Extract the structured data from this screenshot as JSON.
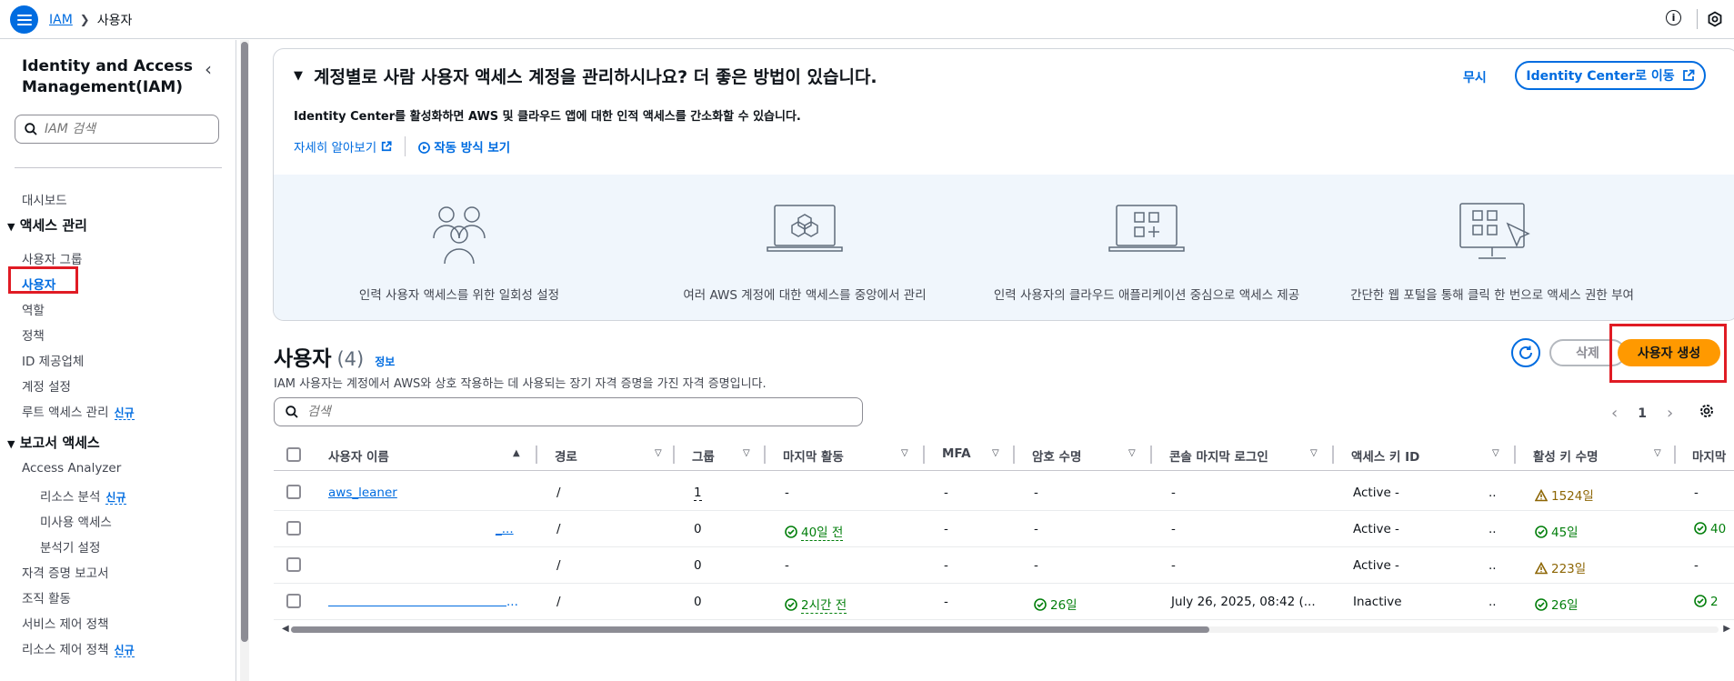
{
  "topbar": {
    "breadcrumb_root": "IAM",
    "breadcrumb_current": "사용자"
  },
  "sidebar": {
    "title": "Identity and Access Management(IAM)",
    "search_placeholder": "IAM 검색",
    "dashboard": "대시보드",
    "access_mgmt": "액세스 관리",
    "user_groups": "사용자 그룹",
    "users": "사용자",
    "roles": "역할",
    "policies": "정책",
    "idp": "ID 제공업체",
    "account_settings": "계정 설정",
    "root_access": "루트 액세스 관리",
    "new_badge": "신규",
    "reports": "보고서 액세스",
    "analyzer": "Access Analyzer",
    "resource_analysis": "리소스 분석",
    "unused_access": "미사용 액세스",
    "analyzer_settings": "분석기 설정",
    "cred_report": "자격 증명 보고서",
    "org_activity": "조직 활동",
    "scp": "서비스 제어 정책",
    "rcp": "리소스 제어 정책"
  },
  "banner": {
    "heading": "계정별로 사람 사용자 액세스 계정을 관리하시나요? 더 좋은 방법이 있습니다.",
    "dismiss": "무시",
    "ic_button": "Identity Center로 이동",
    "subtitle": "Identity Center를 활성화하면 AWS 및 클라우드 앱에 대한 인적 액세스를 간소화할 수 있습니다.",
    "learn_more": "자세히 알아보기",
    "how_it_works": "작동 방식 보기",
    "features": [
      "인력 사용자 액세스를 위한 일회성 설정",
      "여러 AWS 계정에 대한 액세스를 중앙에서 관리",
      "인력 사용자의 클라우드 애플리케이션 중심으로 액세스 제공",
      "간단한 웹 포털을 통해 클릭 한 번으로 액세스 권한 부여"
    ]
  },
  "users": {
    "title": "사용자",
    "count": "(4)",
    "info": "정보",
    "description": "IAM 사용자는 계정에서 AWS와 상호 작용하는 데 사용되는 장기 자격 증명을 가진 자격 증명입니다.",
    "delete": "삭제",
    "create": "사용자 생성",
    "search_placeholder": "검색",
    "page": "1"
  },
  "table": {
    "headers": {
      "name": "사용자 이름",
      "path": "경로",
      "groups": "그룹",
      "last_activity": "마지막 활동",
      "mfa": "MFA",
      "pw_age": "암호 수명",
      "console_login": "콘솔 마지막 로그인",
      "access_key": "액세스 키 ID",
      "key_age": "활성 키 수명",
      "last": "마지막"
    },
    "rows": [
      {
        "name": "aws_leaner",
        "path": "/",
        "groups": "1",
        "activity": "-",
        "mfa": "-",
        "pw": "-",
        "login": "-",
        "key": "Active -",
        "key_tail": "..",
        "age": "1524일",
        "last": "-"
      },
      {
        "name": "_...",
        "path": "/",
        "groups": "0",
        "activity": "40일 전",
        "mfa": "-",
        "pw": "-",
        "login": "-",
        "key": "Active -",
        "key_tail": "..",
        "age": "45일",
        "last": "40"
      },
      {
        "name": "",
        "path": "/",
        "groups": "0",
        "activity": "-",
        "mfa": "-",
        "pw": "-",
        "login": "-",
        "key": "Active -",
        "key_tail": "..",
        "age": "223일",
        "last": "-"
      },
      {
        "name": "...",
        "path": "/",
        "groups": "0",
        "activity": "2시간 전",
        "mfa": "-",
        "pw": "26일",
        "login": "July 26, 2025, 08:42 (...",
        "key": "Inactive",
        "key_tail": "..",
        "age": "26일",
        "last": "2"
      }
    ]
  },
  "colors": {
    "accent": "#006ce0",
    "primary_button": "#ff9900",
    "success": "#037f0c",
    "warning": "#8d6605",
    "highlight": "#e01b24"
  }
}
